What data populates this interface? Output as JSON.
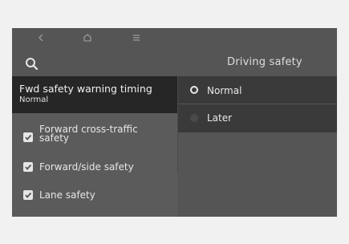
{
  "header": {
    "title": "Driving safety"
  },
  "topbar": {
    "icons": [
      "back-icon",
      "home-icon",
      "menu-icon"
    ]
  },
  "selected_setting": {
    "title": "Fwd safety warning timing",
    "value": "Normal"
  },
  "safety_items": [
    {
      "label_line1": "Forward cross-traffic",
      "label_line2": "safety",
      "checked": true
    },
    {
      "label_line1": "Forward/side safety",
      "label_line2": "",
      "checked": true
    },
    {
      "label_line1": "Lane safety",
      "label_line2": "",
      "checked": true
    }
  ],
  "timing_options": [
    {
      "label": "Normal",
      "selected": true
    },
    {
      "label": "Later",
      "selected": false
    }
  ]
}
